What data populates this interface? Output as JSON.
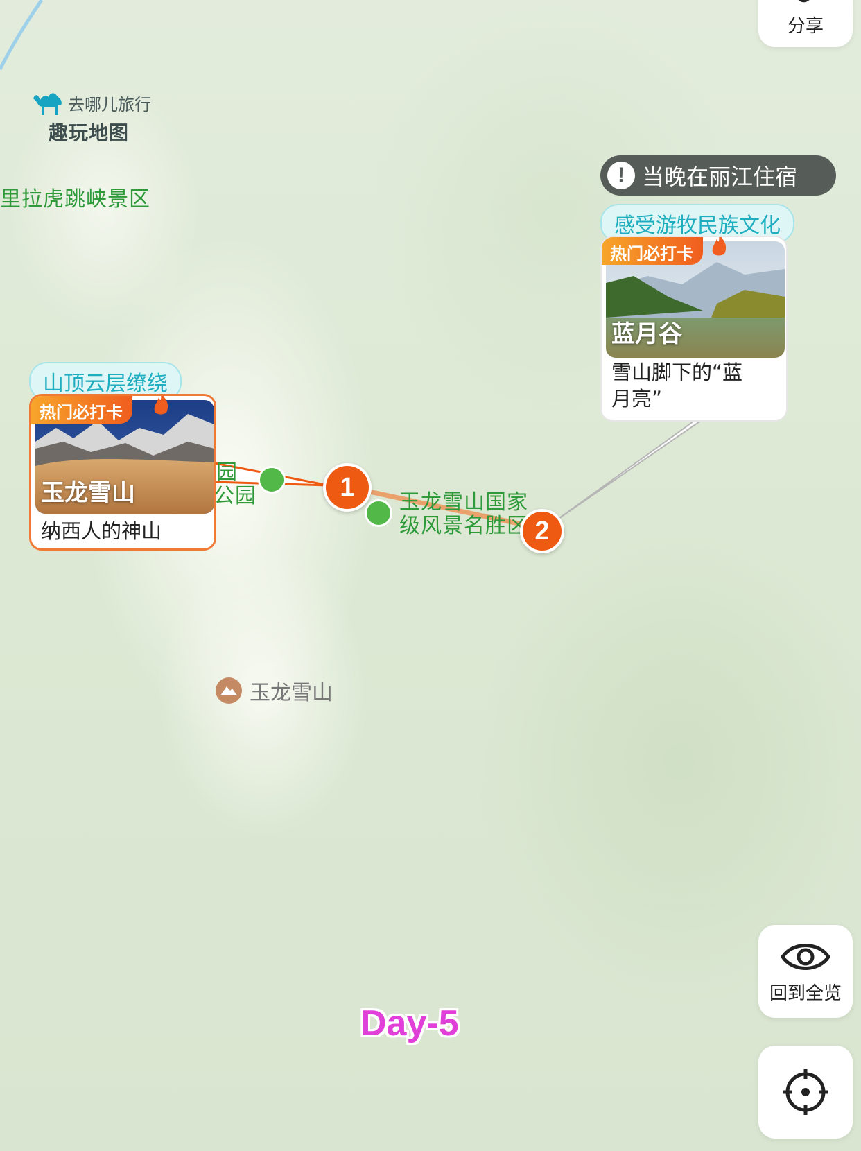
{
  "app": {
    "brand": "去哪儿旅行",
    "product": "趣玩地图"
  },
  "map": {
    "labels": {
      "tiger_leaping": "哈巴雪山自然保护区 虎跳峡景区",
      "tiger_leaping_visible": "里拉虎跳峡景区",
      "park_partial_1": "园",
      "park_partial_2": "公园",
      "scenic_area_line1": "玉龙雪山国家",
      "scenic_area_line2": "级风景名胜区",
      "mountain": "玉龙雪山"
    },
    "colors": {
      "route": "#ee5a12",
      "poi_green": "#52b848",
      "label_green": "#2e9a3a",
      "tagline": "#1eaec0",
      "day_label": "#e040d8"
    }
  },
  "route": {
    "stops": [
      {
        "number": "1"
      },
      {
        "number": "2"
      }
    ]
  },
  "cards": [
    {
      "tagline": "山顶云层缭绕",
      "badge": "热门必打卡",
      "name": "玉龙雪山",
      "description": "纳西人的神山"
    },
    {
      "tagline": "感受游牧民族文化",
      "badge": "热门必打卡",
      "name": "蓝月谷",
      "description_line1": "雪山脚下的“蓝",
      "description_line2": "月亮”"
    }
  ],
  "notice": {
    "icon": "!",
    "text": "当晚在丽江住宿"
  },
  "controls": {
    "share_label": "分享",
    "overview_label": "回到全览",
    "share_icon": "share-icon",
    "overview_icon": "eye-icon",
    "locate_icon": "locate-crosshair-icon"
  },
  "day_label": "Day-5"
}
